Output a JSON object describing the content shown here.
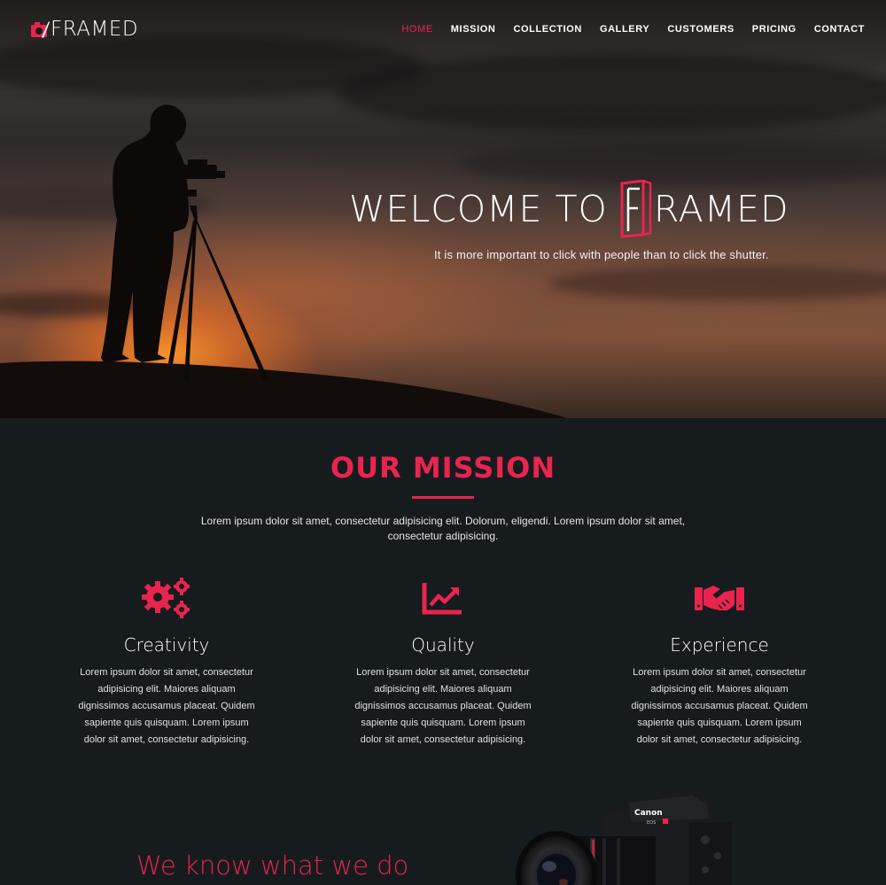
{
  "brand": {
    "name": "FRAMED",
    "accent": "#e8244f",
    "logo_icon": "camera-frame-icon"
  },
  "nav": {
    "items": [
      {
        "label": "HOME",
        "active": true
      },
      {
        "label": "MISSION",
        "active": false
      },
      {
        "label": "COLLECTION",
        "active": false
      },
      {
        "label": "GALLERY",
        "active": false
      },
      {
        "label": "CUSTOMERS",
        "active": false
      },
      {
        "label": "PRICING",
        "active": false
      },
      {
        "label": "CONTACT",
        "active": false
      }
    ]
  },
  "hero": {
    "title_prefix": "WELCOME TO",
    "title_brand_rest": "RAMED",
    "title_brand_initial": "F",
    "subtitle": "It is more important to click with people than to click the shutter."
  },
  "mission": {
    "title": "OUR MISSION",
    "text": "Lorem ipsum dolor sit amet, consectetur adipisicing elit. Dolorum, eligendi. Lorem ipsum dolor sit amet, consectetur adipisicing.",
    "features": [
      {
        "icon": "gears-icon",
        "title": "Creativity",
        "text": "Lorem ipsum dolor sit amet, consectetur adipisicing elit. Maiores aliquam dignissimos accusamus placeat. Quidem sapiente quis quisquam. Lorem ipsum dolor sit amet, consectetur adipisicing."
      },
      {
        "icon": "chart-line-icon",
        "title": "Quality",
        "text": "Lorem ipsum dolor sit amet, consectetur adipisicing elit. Maiores aliquam dignissimos accusamus placeat. Quidem sapiente quis quisquam. Lorem ipsum dolor sit amet, consectetur adipisicing."
      },
      {
        "icon": "handshake-icon",
        "title": "Experience",
        "text": "Lorem ipsum dolor sit amet, consectetur adipisicing elit. Maiores aliquam dignissimos accusamus placeat. Quidem sapiente quis quisquam. Lorem ipsum dolor sit amet, consectetur adipisicing."
      }
    ]
  },
  "about": {
    "heading": "We know what we do"
  },
  "camera": {
    "brand": "Canon",
    "model": "EOS"
  }
}
